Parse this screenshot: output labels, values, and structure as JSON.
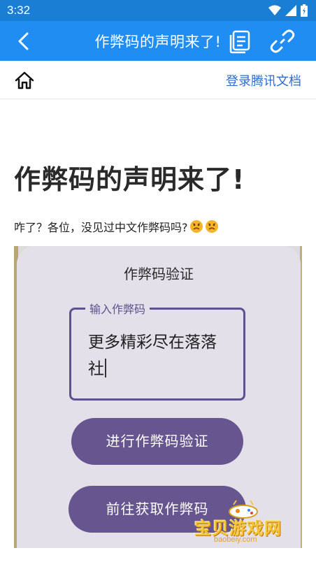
{
  "status_bar": {
    "time": "3:32"
  },
  "app_bar": {
    "title": "作弊码的声明来了!"
  },
  "toolbar": {
    "login_link": "登录腾讯文档"
  },
  "document": {
    "title": "作弊码的声明来了!",
    "line1": "咋了？各位，没见过中文作弊码吗?"
  },
  "embedded_screenshot": {
    "dialog_title": "作弊码验证",
    "input_label": "输入作弊码",
    "input_value": "更多精彩尽在落落社",
    "verify_button": "进行作弊码验证",
    "get_button": "前往获取作弊码"
  },
  "watermark": {
    "main": "宝贝游戏网",
    "sub": "baobeiy.com"
  },
  "colors": {
    "status_bar": "#1a7fd4",
    "app_bar": "#1f8df2",
    "link": "#2f6dcc",
    "dialog_bg": "#e4e0ea",
    "accent_purple": "#66558f"
  }
}
